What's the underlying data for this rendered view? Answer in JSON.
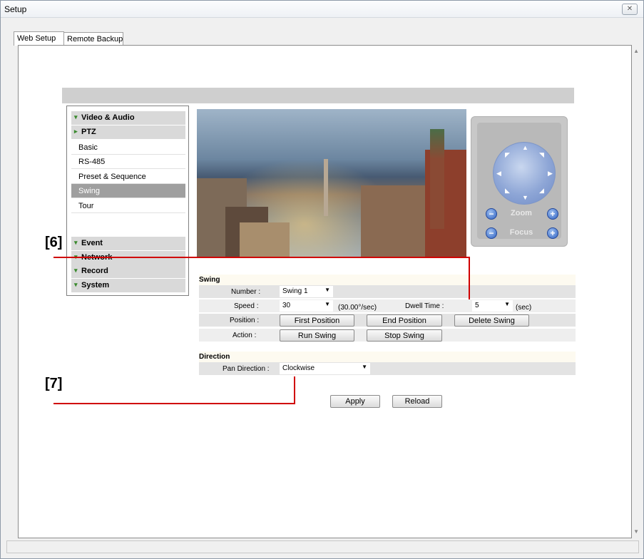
{
  "window": {
    "title": "Setup",
    "close_icon": "close-icon"
  },
  "tabs": [
    {
      "label": "Web Setup",
      "active": true
    },
    {
      "label": "Remote Backup",
      "active": false
    }
  ],
  "sidebar": {
    "sections": {
      "video_audio": "Video & Audio",
      "ptz": "PTZ",
      "event": "Event",
      "network": "Network",
      "record": "Record",
      "system": "System"
    },
    "ptz_items": [
      "Basic",
      "RS-485",
      "Preset & Sequence",
      "Swing",
      "Tour"
    ],
    "selected": "Swing"
  },
  "ptz_control": {
    "zoom_label": "Zoom",
    "focus_label": "Focus"
  },
  "swing": {
    "title": "Swing",
    "number_label": "Number :",
    "number_value": "Swing 1",
    "speed_label": "Speed :",
    "speed_value": "30",
    "speed_unit": "(30.00°/sec)",
    "dwell_label": "Dwell Time :",
    "dwell_value": "5",
    "dwell_unit": "(sec)",
    "position_label": "Position :",
    "first_position": "First Position",
    "end_position": "End Position",
    "delete_swing": "Delete Swing",
    "action_label": "Action :",
    "run_swing": "Run Swing",
    "stop_swing": "Stop Swing"
  },
  "direction": {
    "title": "Direction",
    "pan_label": "Pan Direction :",
    "pan_value": "Clockwise"
  },
  "footer": {
    "apply": "Apply",
    "reload": "Reload"
  },
  "annotations": {
    "six": "[6]",
    "seven": "[7]"
  },
  "colors": {
    "annotation_line": "#d00000",
    "selected_nav": "#9f9f9f"
  }
}
